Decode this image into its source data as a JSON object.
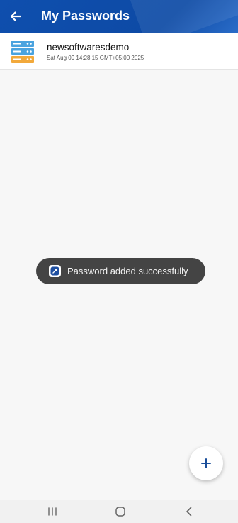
{
  "app": {
    "title": "My Passwords",
    "accent_color": "#0f4fae"
  },
  "header": {
    "back_icon": "arrow-left-icon"
  },
  "passwords": [
    {
      "name": "newsoftwaresdemo",
      "date": "Sat Aug 09 14:28:15 GMT+05:00 2025",
      "icon": "server-icon"
    }
  ],
  "toast": {
    "message": "Password added successfully",
    "icon": "app-icon"
  },
  "fab": {
    "icon": "plus-icon"
  },
  "navbar": {
    "recents_icon": "recents-icon",
    "home_icon": "home-icon",
    "back_icon": "back-chevron-icon"
  }
}
